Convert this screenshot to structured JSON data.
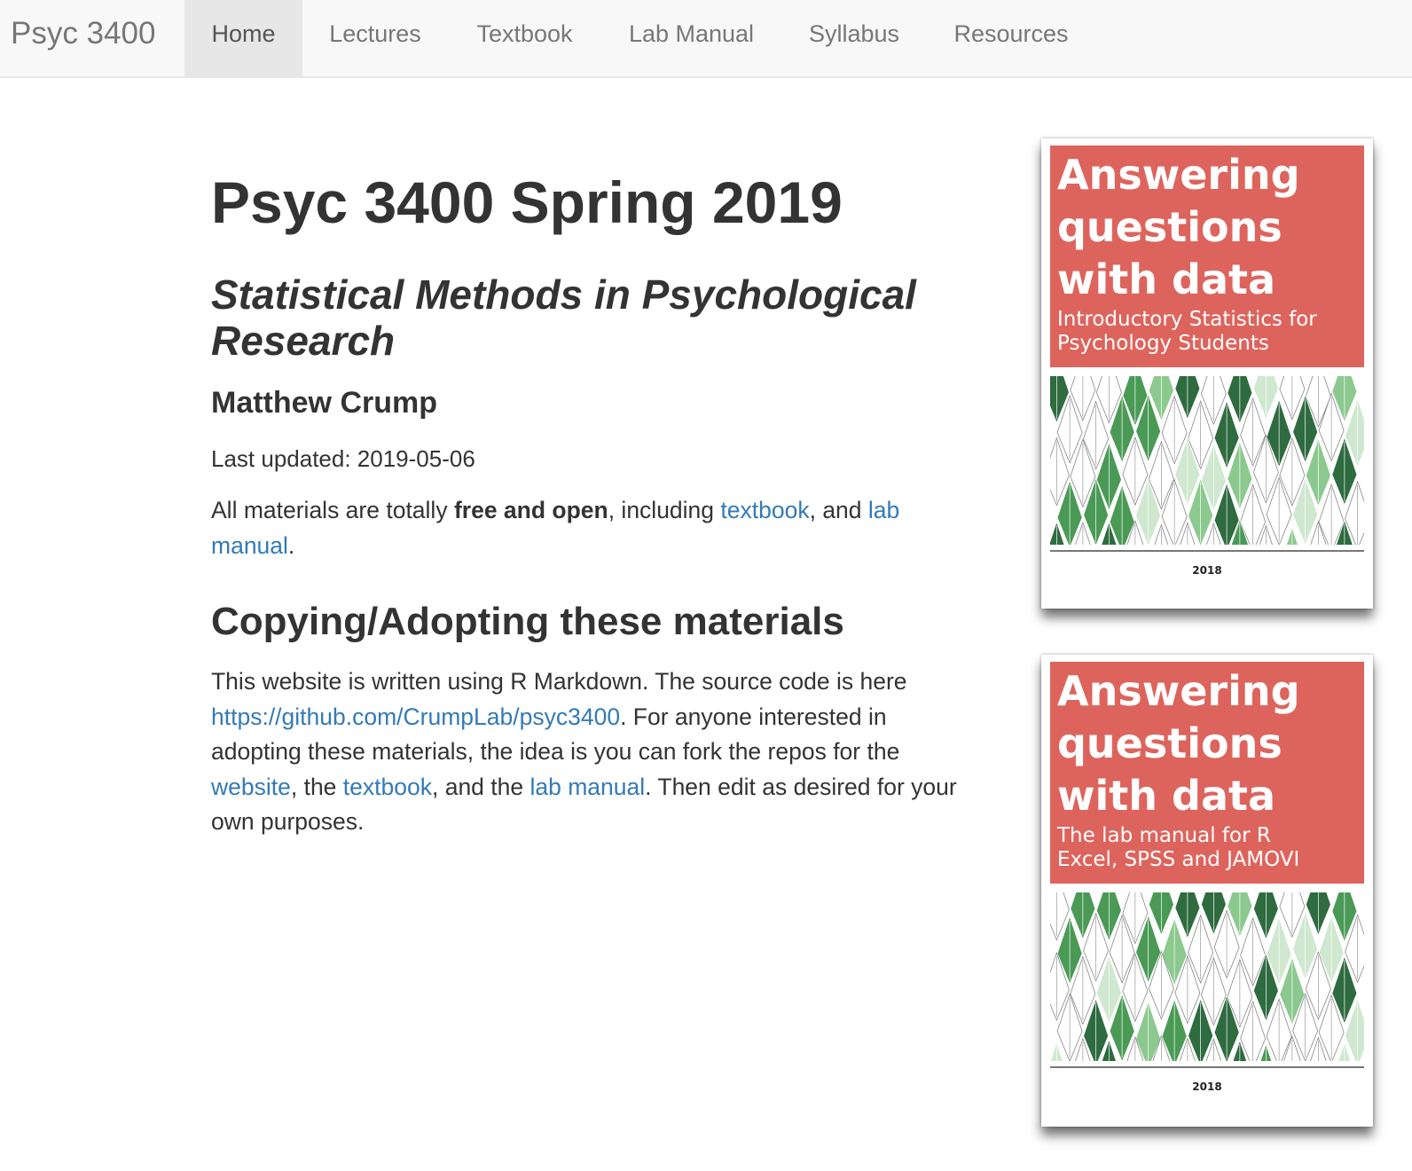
{
  "navbar": {
    "brand": "Psyc 3400",
    "items": [
      {
        "label": "Home",
        "active": true
      },
      {
        "label": "Lectures",
        "active": false
      },
      {
        "label": "Textbook",
        "active": false
      },
      {
        "label": "Lab Manual",
        "active": false
      },
      {
        "label": "Syllabus",
        "active": false
      },
      {
        "label": "Resources",
        "active": false
      }
    ]
  },
  "main": {
    "title": "Psyc 3400 Spring 2019",
    "subtitle": "Statistical Methods in Psychological Research",
    "author": "Matthew Crump",
    "date": "Last updated: 2019-05-06",
    "intro": {
      "text1": "All materials are totally ",
      "bold": "free and open",
      "text2": ", including ",
      "link_textbook": "textbook",
      "text3": ", and ",
      "link_lab_manual": "lab manual",
      "text4": "."
    },
    "section_heading": "Copying/Adopting these materials",
    "section_body": {
      "text1": "This website is written using R Markdown. The source code is here ",
      "link_repo": "https://github.com/CrumpLab/psyc3400",
      "text2": ". For anyone interested in adopting these materials, the idea is you can fork the repos for the ",
      "link_website": "website",
      "text3": ", the ",
      "link_textbook": "textbook",
      "text4": ", and the ",
      "link_lab_manual": "lab manual",
      "text5": ". Then edit as desired for your own purposes."
    }
  },
  "books": [
    {
      "title": "Answering\nquestions\nwith data",
      "subtitle": "Introductory  Statistics  for\nPsychology Students",
      "year": "2018",
      "cover_color": "#dd645d"
    },
    {
      "title": "Answering\nquestions\nwith data",
      "subtitle": "The lab manual for R\nExcel, SPSS and JAMOVI",
      "year": "2018",
      "cover_color": "#dd645d"
    }
  ],
  "colors": {
    "link": "#337ab7",
    "navbar_bg": "#f8f8f8",
    "nav_active_bg": "#e7e7e7",
    "tree_greens": [
      "#2e6b3f",
      "#4a9a55",
      "#8cc98f",
      "#cfe8cf"
    ]
  }
}
